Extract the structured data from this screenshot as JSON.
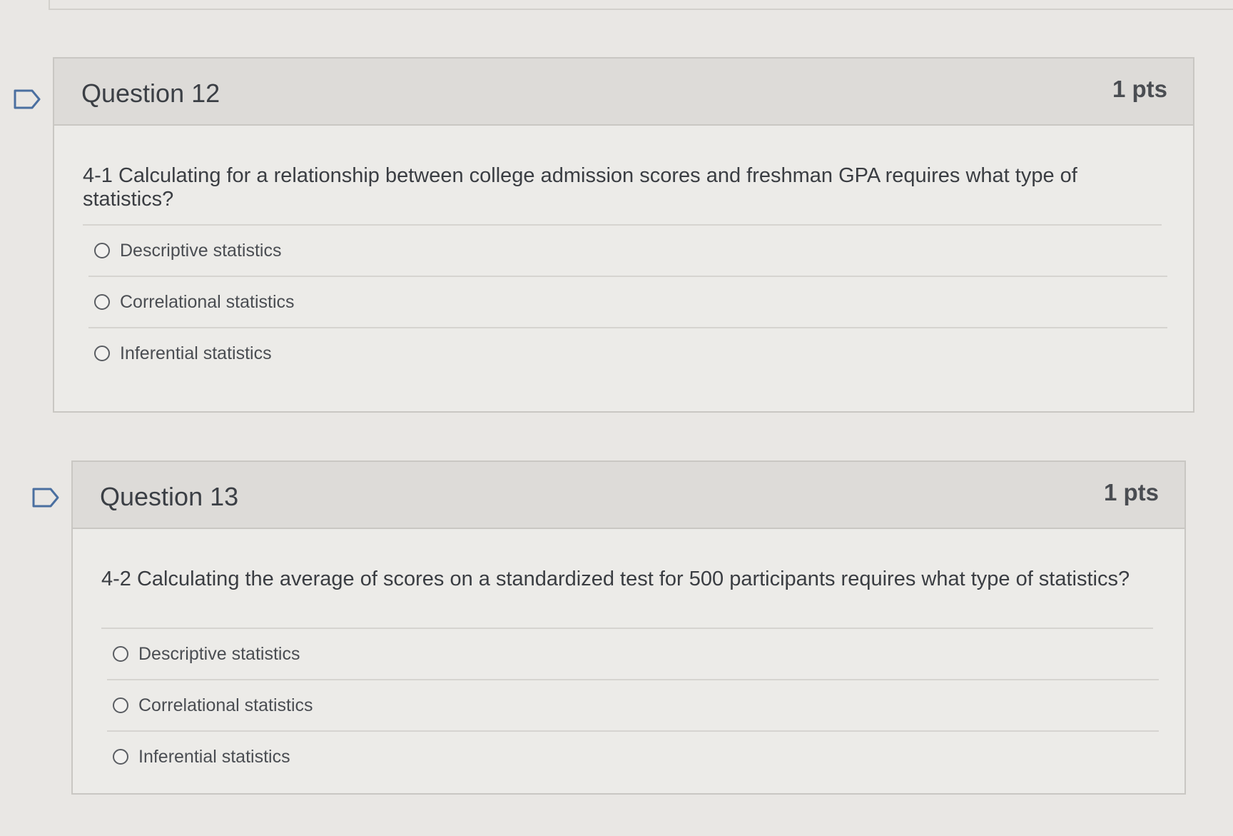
{
  "questions": [
    {
      "title": "Question 12",
      "points": "1 pts",
      "text": "4-1 Calculating for a relationship between college admission scores and freshman GPA requires what type of statistics?",
      "answers": [
        "Descriptive statistics",
        "Correlational statistics",
        "Inferential statistics"
      ]
    },
    {
      "title": "Question 13",
      "points": "1 pts",
      "text": "4-2 Calculating the average of scores on a standardized test for 500 participants requires what type of statistics?",
      "answers": [
        "Descriptive statistics",
        "Correlational statistics",
        "Inferential statistics"
      ]
    }
  ],
  "icons": {
    "flag": "flag-question-icon",
    "radio": "radio-button-icon"
  },
  "colors": {
    "page_background": "#e9e7e4",
    "header_background": "#dddbd8",
    "border": "#c9c7c3",
    "text": "#3a3d42"
  }
}
